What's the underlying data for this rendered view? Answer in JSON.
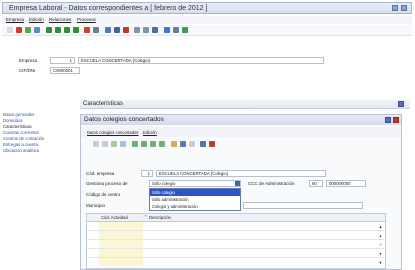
{
  "window": {
    "title": "Empresa Laboral - Datos correspondientes a [ febrero de 2012 ]",
    "title_buttons": [
      "restore-icon",
      "close-icon"
    ]
  },
  "menu": {
    "items": [
      "Empresa",
      "Edición",
      "Relaciones",
      "Procesos"
    ]
  },
  "toolbar": {
    "icons": [
      "new-icon",
      "delete-icon",
      "confirm-icon",
      "undo-icon",
      "first-icon",
      "prev-icon",
      "next-icon",
      "last-icon",
      "home-icon",
      "grid-icon",
      "search-icon",
      "filter-icon",
      "clear-filter-icon",
      "print-icon",
      "preview-icon",
      "export-icon",
      "report-icon",
      "help-icon",
      "settings-icon"
    ]
  },
  "header": {
    "empresa_label": "Empresa",
    "empresa_num": "1",
    "empresa_name": "ESCUELA CONCERTADA (Colegio)",
    "cif_label": "CIF/DNI",
    "cif_value": "C0000001"
  },
  "section": {
    "title": "Características"
  },
  "nav": {
    "items": [
      "Datos generales",
      "Domicilios",
      "Características",
      "Cuentas corrientes",
      "Centros de cotización",
      "Entregas a cuenta",
      "Ubicación analítica"
    ],
    "active_index": 2
  },
  "dialog": {
    "title": "Datos colegios concertados",
    "sub_menu": [
      "Datos colegios concertados",
      "Edición"
    ],
    "cod_empresa_label": "Cód. empresa",
    "cod_empresa_num": "1",
    "cod_empresa_name": "ESCUELA CONCERTADA (Colegio)",
    "gestiona_label": "Gestiona proceso de",
    "gestiona_value": "Sólo colegio",
    "gestiona_options": [
      "Sólo colegio",
      "Sólo administración",
      "Colegio y administración"
    ],
    "gestiona_selected": 0,
    "ccc_label": "CCC de Administración",
    "ccc_a": "60",
    "ccc_b": "000000000",
    "codigo_centro_label": "Código de centro",
    "municipio_label": "Municipio",
    "grid_headers": [
      "Cód. Actividad",
      "Descripción"
    ],
    "grid_required_mark": "*"
  }
}
